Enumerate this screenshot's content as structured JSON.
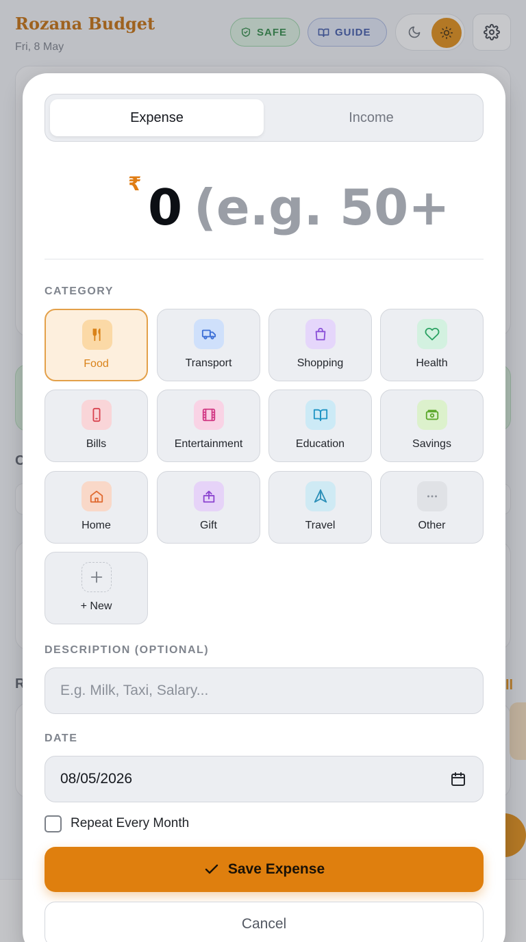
{
  "app": {
    "title": "Rozana Budget",
    "date": "Fri, 8 May",
    "safe_label": "SAFE",
    "guide_label": "GUIDE",
    "bg_letter_1": "C",
    "bg_letter_2": "R"
  },
  "modal": {
    "tabs": [
      {
        "label": "Expense",
        "active": true
      },
      {
        "label": "Income",
        "active": false
      }
    ],
    "currency_symbol": "₹",
    "amount_value": "0",
    "amount_hint": "(e.g. 50+",
    "category_label": "CATEGORY",
    "categories": [
      {
        "label": "Food",
        "icon": "utensils-icon",
        "selected": true
      },
      {
        "label": "Transport",
        "icon": "truck-icon",
        "selected": false
      },
      {
        "label": "Shopping",
        "icon": "shopping-bag-icon",
        "selected": false
      },
      {
        "label": "Health",
        "icon": "heart-icon",
        "selected": false
      },
      {
        "label": "Bills",
        "icon": "smartphone-icon",
        "selected": false
      },
      {
        "label": "Entertainment",
        "icon": "film-icon",
        "selected": false
      },
      {
        "label": "Education",
        "icon": "book-open-icon",
        "selected": false
      },
      {
        "label": "Savings",
        "icon": "wallet-icon",
        "selected": false
      },
      {
        "label": "Home",
        "icon": "home-icon",
        "selected": false
      },
      {
        "label": "Gift",
        "icon": "gift-icon",
        "selected": false
      },
      {
        "label": "Travel",
        "icon": "navigation-icon",
        "selected": false
      },
      {
        "label": "Other",
        "icon": "more-horizontal-icon",
        "selected": false
      },
      {
        "label": "+ New",
        "icon": "plus-icon",
        "selected": false
      }
    ],
    "description_label": "DESCRIPTION (OPTIONAL)",
    "description_placeholder": "E.g. Milk, Taxi, Salary...",
    "date_label": "DATE",
    "date_value": "08/05/2026",
    "repeat_label": "Repeat Every Month",
    "repeat_checked": false,
    "save_label": "Save Expense",
    "cancel_label": "Cancel"
  },
  "colors": {
    "accent": "#df7f0e",
    "selected_bg": "#fdefdd",
    "safe_green": "#2f8a45",
    "guide_blue": "#3d56a8"
  }
}
